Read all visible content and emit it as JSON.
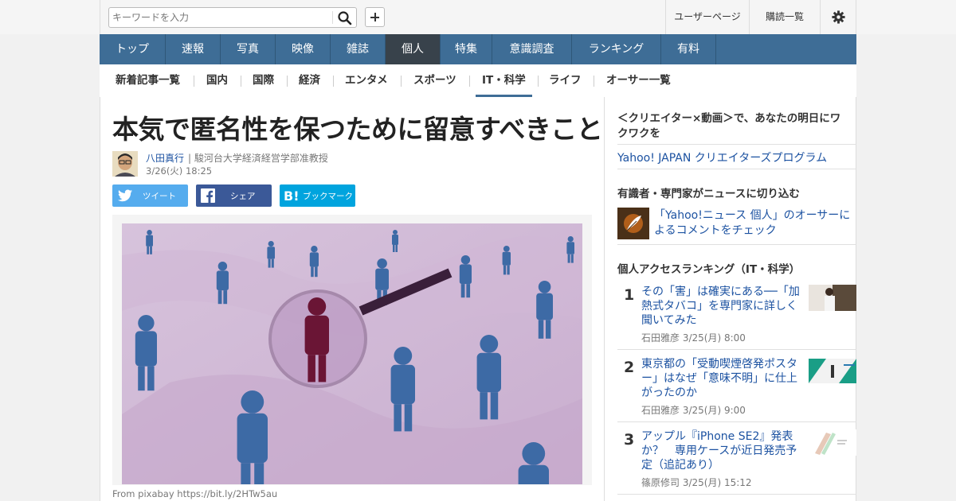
{
  "header": {
    "search_placeholder": "キーワードを入力",
    "user_page": "ユーザーページ",
    "subscriptions": "購読一覧"
  },
  "nav": {
    "items": [
      {
        "label": "トップ"
      },
      {
        "label": "速報"
      },
      {
        "label": "写真"
      },
      {
        "label": "映像"
      },
      {
        "label": "雑誌"
      },
      {
        "label": "個人",
        "active": true
      },
      {
        "label": "特集"
      },
      {
        "label": "意識調査"
      },
      {
        "label": "ランキング"
      },
      {
        "label": "有料"
      }
    ]
  },
  "subnav": {
    "items": [
      {
        "label": "新着記事一覧"
      },
      {
        "label": "国内"
      },
      {
        "label": "国際"
      },
      {
        "label": "経済"
      },
      {
        "label": "エンタメ"
      },
      {
        "label": "スポーツ"
      },
      {
        "label": "IT・科学",
        "active": true
      },
      {
        "label": "ライフ"
      },
      {
        "label": "オーサー一覧"
      }
    ]
  },
  "article": {
    "title": "本気で匿名性を保つために留意すべきこと",
    "author_name": "八田真行",
    "author_title": "| 駿河台大学経済経営学部准教授",
    "date": "3/26(火) 18:25",
    "share": {
      "twitter": "ツイート",
      "facebook": "シェア",
      "hatena": "ブックマーク"
    },
    "caption": "From pixabay https://bit.ly/2HTw5au"
  },
  "sidebar": {
    "promo_heading": "＜クリエイター×動画＞で、あなたの明日にワクワクを",
    "promo_link": "Yahoo! JAPAN クリエイターズプログラム",
    "expert_heading": "有識者・専門家がニュースに切り込む",
    "expert_link": "「Yahoo!ニュース 個人」のオーサーによるコメントをチェック",
    "ranking_heading": "個人アクセスランキング（IT・科学）",
    "ranking": [
      {
        "rank": "1",
        "title": "その「害」は確実にある──「加熱式タバコ」を専門家に詳しく聞いてみた",
        "author": "石田雅彦",
        "date": "3/25(月) 8:00"
      },
      {
        "rank": "2",
        "title": "東京都の「受動喫煙啓発ポスター」はなぜ「意味不明」に仕上がったのか",
        "author": "石田雅彦",
        "date": "3/25(月) 9:00"
      },
      {
        "rank": "3",
        "title": "アップル『iPhone SE2』発表か？　専用ケースが近日発売予定（追記あり）",
        "author": "篠原修司",
        "date": "3/25(月) 15:12"
      }
    ]
  },
  "colors": {
    "nav_bg": "#3e6d96",
    "nav_active": "#38424b",
    "link": "#1c52a1",
    "twitter": "#55acee",
    "facebook": "#3b5998",
    "hatena": "#00a4de"
  }
}
